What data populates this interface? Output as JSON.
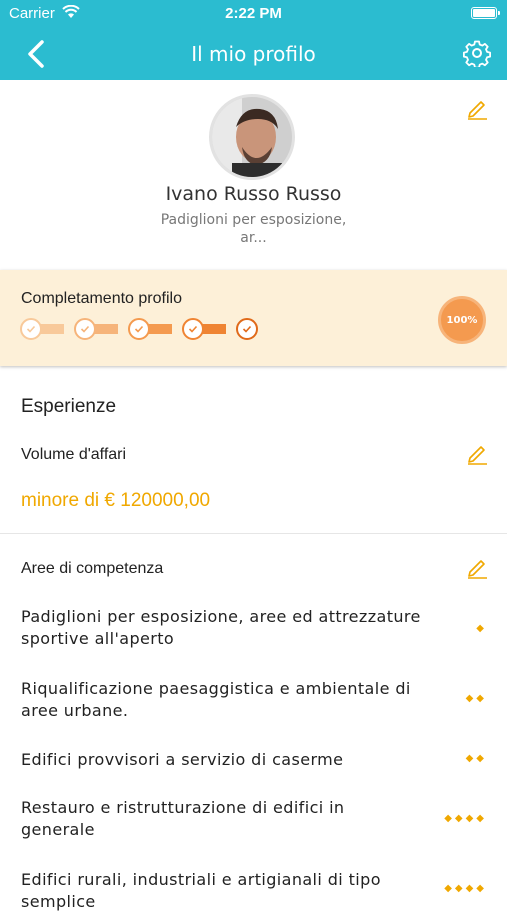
{
  "status_bar": {
    "carrier": "Carrier",
    "time": "2:22 PM"
  },
  "nav": {
    "title": "Il mio profilo",
    "back_icon": "chevron-left-icon",
    "settings_icon": "gear-icon"
  },
  "profile": {
    "name": "Ivano Russo Russo",
    "subtitle_line1": "Padiglioni per esposizione,",
    "subtitle_line2": "ar..."
  },
  "completion": {
    "label": "Completamento profilo",
    "steps": 5,
    "completed": 5,
    "percent": "100%"
  },
  "experience": {
    "title": "Esperienze",
    "volume_label": "Volume d'affari",
    "volume_value": "minore di € 120000,00",
    "areas_label": "Aree di competenza",
    "areas": [
      {
        "line1": "Padiglioni per esposizione, aree ed attrezzature",
        "line2": "sportive all'aperto",
        "level": 1
      },
      {
        "line1": "Riqualificazione paesaggistica e ambientale di",
        "line2": "aree urbane.",
        "level": 2
      },
      {
        "line1": "Edifici provvisori a servizio di caserme",
        "line2": "",
        "level": 2
      },
      {
        "line1": "Restauro e ristrutturazione di edifici in",
        "line2": "generale",
        "level": 4
      },
      {
        "line1": "Edifici rurali, industriali e artigianali di tipo",
        "line2": "semplice",
        "level": 4
      }
    ]
  },
  "colors": {
    "primary": "#2bbcd0",
    "accent": "#f0a800",
    "progress": "#f49a4f",
    "completion_bg": "#fdf0d8"
  }
}
